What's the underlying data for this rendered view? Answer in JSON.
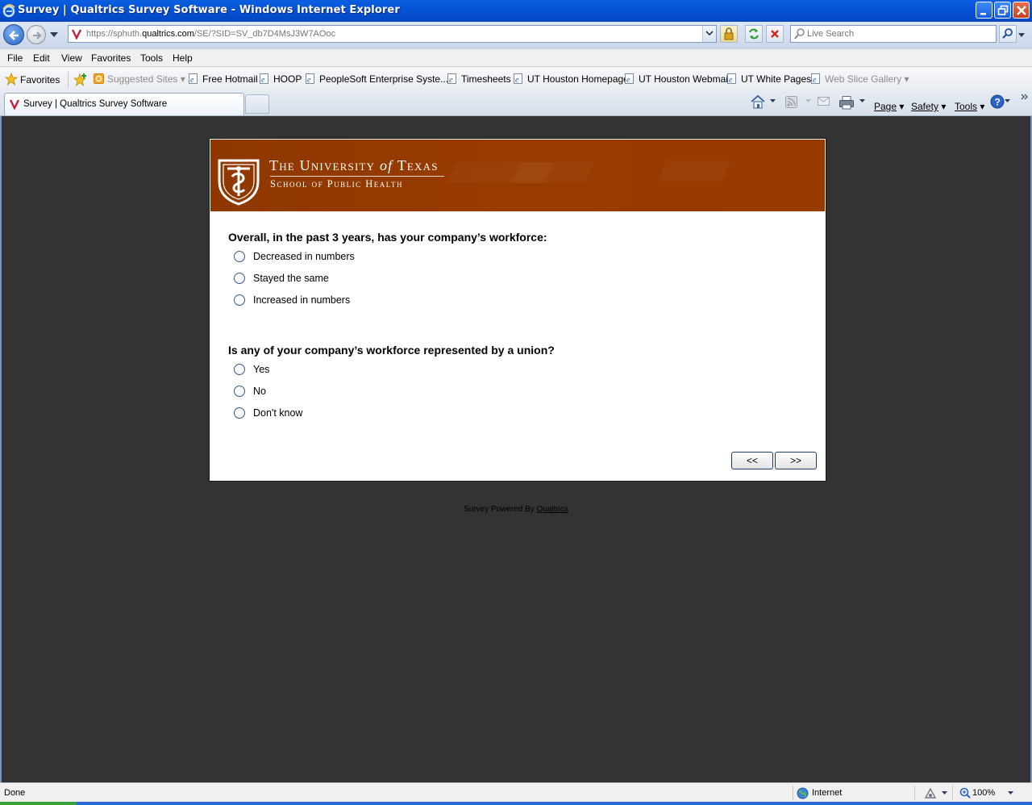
{
  "window": {
    "title": "Survey | Qualtrics Survey Software - Windows Internet Explorer"
  },
  "address": {
    "url_prefix": "https://sphuth.",
    "url_domain": "qualtrics.com",
    "url_path": "/SE/?SID=SV_db7D4MsJ3W7AOoc",
    "search_placeholder": "Live Search"
  },
  "menu": [
    "File",
    "Edit",
    "View",
    "Favorites",
    "Tools",
    "Help"
  ],
  "favorites": {
    "label": "Favorites",
    "items": [
      "Suggested Sites ▾",
      "Free Hotmail",
      "HOOP",
      "PeopleSoft Enterprise Syste...",
      "Timesheets",
      "UT Houston Homepage",
      "UT Houston Webmail",
      "UT White Pages",
      "Web Slice Gallery ▾"
    ]
  },
  "tab": {
    "title": "Survey | Qualtrics Survey Software"
  },
  "commandbar": {
    "page": "Page",
    "safety": "Safety",
    "tools": "Tools"
  },
  "banner": {
    "line1_a": "The University ",
    "line1_of": "of",
    "line1_b": " Texas",
    "line2": "School of Public Health"
  },
  "questions": [
    {
      "text": "Overall, in the past 3 years, has your company’s workforce:",
      "choices": [
        "Decreased in numbers",
        "Stayed the same",
        "Increased in numbers"
      ]
    },
    {
      "text": "Is any of your company’s workforce represented by a union?",
      "choices": [
        "Yes",
        "No",
        "Don't know"
      ]
    }
  ],
  "nav": {
    "back": "<<",
    "next": ">>"
  },
  "footer": {
    "powered_by": "Survey Powered By ",
    "link": "Qualtrics"
  },
  "status": {
    "left": "Done",
    "zone": "Internet",
    "zoom": "100%"
  },
  "colors": {
    "banner": "#983b00",
    "background": "#333333"
  }
}
